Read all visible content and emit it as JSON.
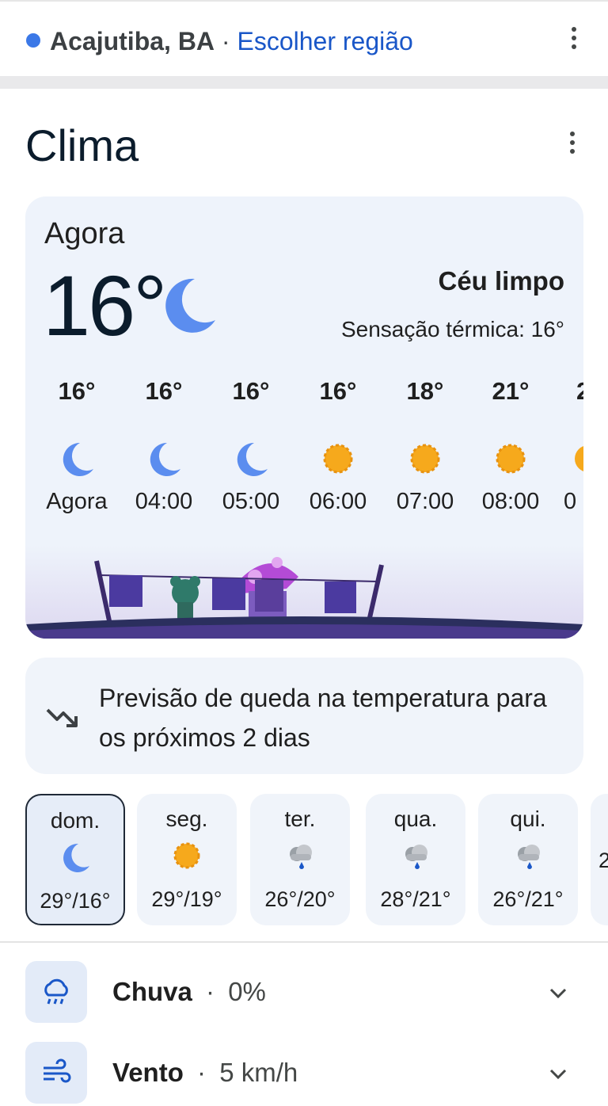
{
  "location": {
    "city": "Acajutiba, BA",
    "separator": "·",
    "choose_region": "Escolher região"
  },
  "title": "Clima",
  "current": {
    "label": "Agora",
    "temperature": "16°",
    "condition": "Céu limpo",
    "feels_like": "Sensação térmica: 16°",
    "icon": "moon-icon"
  },
  "hourly": [
    {
      "temp": "16°",
      "icon": "moon-icon",
      "time": "Agora"
    },
    {
      "temp": "16°",
      "icon": "moon-icon",
      "time": "04:00"
    },
    {
      "temp": "16°",
      "icon": "moon-icon",
      "time": "05:00"
    },
    {
      "temp": "16°",
      "icon": "sun-icon",
      "time": "06:00"
    },
    {
      "temp": "18°",
      "icon": "sun-icon",
      "time": "07:00"
    },
    {
      "temp": "21°",
      "icon": "sun-icon",
      "time": "08:00"
    },
    {
      "temp": "2",
      "icon": "sun-icon",
      "time": "0"
    }
  ],
  "trend": {
    "icon": "trending-down-icon",
    "text": "Previsão de queda na temperatura para os próximos 2 dias"
  },
  "daily": [
    {
      "day": "dom.",
      "icon": "moon-icon",
      "range": "29°/16°",
      "selected": true
    },
    {
      "day": "seg.",
      "icon": "sun-icon",
      "range": "29°/19°"
    },
    {
      "day": "ter.",
      "icon": "rain-cloud-icon",
      "range": "26°/20°"
    },
    {
      "day": "qua.",
      "icon": "rain-cloud-icon",
      "range": "28°/21°"
    },
    {
      "day": "qui.",
      "icon": "rain-cloud-icon",
      "range": "26°/21°"
    },
    {
      "day": "",
      "icon": "",
      "range": "2"
    }
  ],
  "details": [
    {
      "name": "Chuva",
      "separator": "·",
      "value": "0%",
      "icon": "rain-icon"
    },
    {
      "name": "Vento",
      "separator": "·",
      "value": "5 km/h",
      "icon": "wind-icon"
    }
  ],
  "colors": {
    "accent": "#1a57c8",
    "moon": "#5b8def",
    "sun": "#f6a91c",
    "card": "#eef3fb"
  }
}
